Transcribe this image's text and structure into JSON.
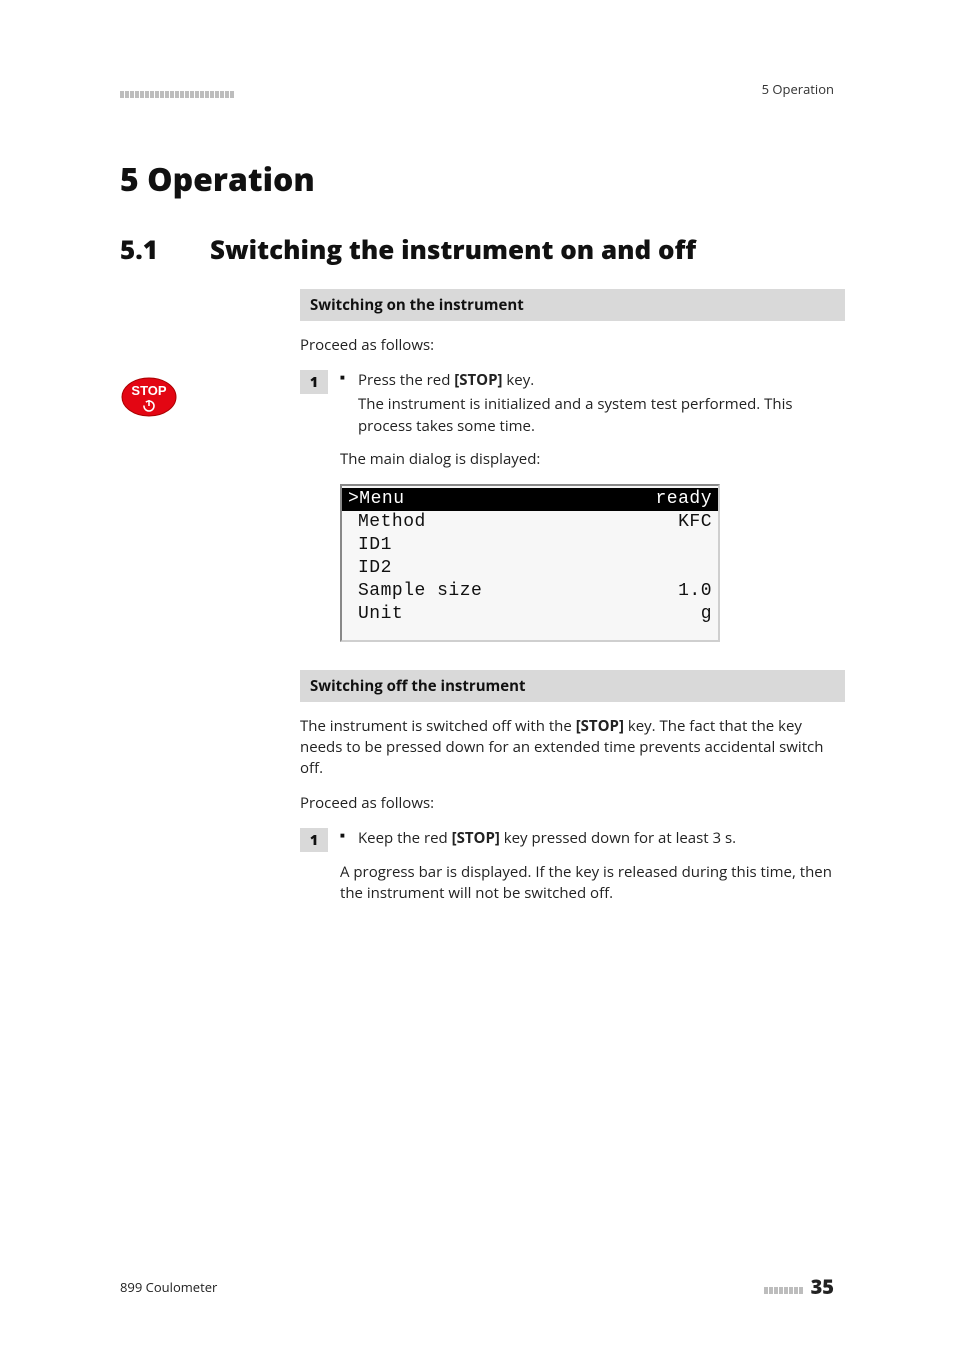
{
  "header": {
    "right": "5 Operation"
  },
  "chapter": {
    "number": "5",
    "title": "Operation",
    "heading": "5   Operation"
  },
  "section": {
    "number": "5.1",
    "title": "Switching the instrument on and off"
  },
  "switch_on": {
    "bar": "Switching on the instrument",
    "proceed": "Proceed as follows:",
    "step1_num": "1",
    "step1_bullet_pre": "Press the red ",
    "step1_bullet_bold": "[STOP]",
    "step1_bullet_post": " key.",
    "step1_line2": "The instrument is initialized and a system test performed. This process takes some time.",
    "main_dialog": "The main dialog is displayed:"
  },
  "lcd": {
    "r1l": ">Menu",
    "r1r": "ready",
    "r2l": "Method",
    "r2r": "KFC",
    "r3l": "ID1",
    "r3r": "",
    "r4l": "ID2",
    "r4r": "",
    "r5l": "Sample size",
    "r5r": "1.0",
    "r6l": "Unit",
    "r6r": "g"
  },
  "switch_off": {
    "bar": "Switching off the instrument",
    "para_pre": "The instrument is switched off with the ",
    "para_bold": "[STOP]",
    "para_post": " key. The fact that the key needs to be pressed down for an extended time prevents accidental switch off.",
    "proceed": "Proceed as follows:",
    "step1_num": "1",
    "step1_bullet_pre": "Keep the red ",
    "step1_bullet_bold": "[STOP]",
    "step1_bullet_post": " key pressed down for at least 3 s.",
    "step1_line2": "A progress bar is displayed. If the key is released during this time, then the instrument will not be switched off."
  },
  "footer": {
    "left": "899 Coulometer",
    "page": "35"
  },
  "icons": {
    "stop": "stop-key-icon"
  }
}
